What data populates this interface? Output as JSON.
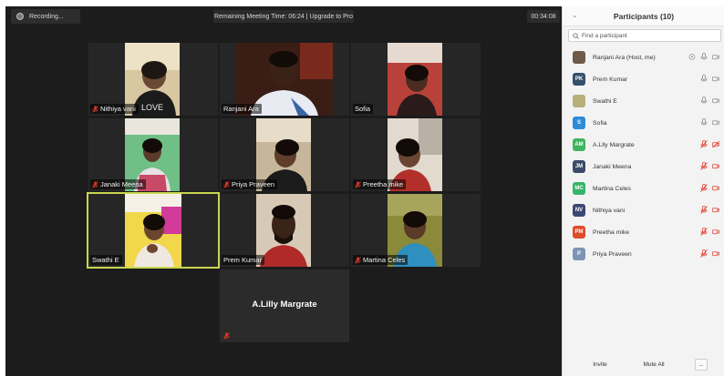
{
  "topbar": {
    "recording_label": "Recording...",
    "banner_text": "Remaining Meeting Time: 06:24 | Upgrade to Pro",
    "timer": "00:34:08"
  },
  "tiles": {
    "nithiya": "Nithiya vani",
    "ranjani": "Ranjani Ara",
    "sofia": "Sofia",
    "janaki": "Janaki Meena",
    "priya": "Priya Praveen",
    "preetha": "Preetha mike",
    "swathi": "Swathi E",
    "prem": "Prem Kumar",
    "martina": "Martina Celes",
    "alilly": "A.Lilly Margrate"
  },
  "panel": {
    "title": "Participants (10)",
    "search_placeholder": "Find a participant",
    "invite_label": "Invite",
    "mute_all_label": "Mute All",
    "more_label": "...",
    "participants": [
      {
        "name": "Ranjani Ara (Host, me)",
        "initials": "",
        "color": "#6d5a4a",
        "muted": false
      },
      {
        "name": "Prem Kumar",
        "initials": "PK",
        "color": "#35506b",
        "muted": false
      },
      {
        "name": "Swathi E",
        "initials": "",
        "color": "#b7b07a",
        "muted": false
      },
      {
        "name": "Sofia",
        "initials": "S",
        "color": "#2e8bd8",
        "muted": false
      },
      {
        "name": "A.Llly Margrate",
        "initials": "AM",
        "color": "#3fb45f",
        "muted": true
      },
      {
        "name": "Janaki Meena",
        "initials": "JM",
        "color": "#3b4a66",
        "muted": true
      },
      {
        "name": "Martina Celes",
        "initials": "MC",
        "color": "#36b56a",
        "muted": true
      },
      {
        "name": "Nithiya vani",
        "initials": "NV",
        "color": "#3b4873",
        "muted": true
      },
      {
        "name": "Preetha mike",
        "initials": "PM",
        "color": "#e04c2a",
        "muted": true
      },
      {
        "name": "Priya Praveen",
        "initials": "P",
        "color": "#7e93b5",
        "muted": true
      }
    ]
  }
}
